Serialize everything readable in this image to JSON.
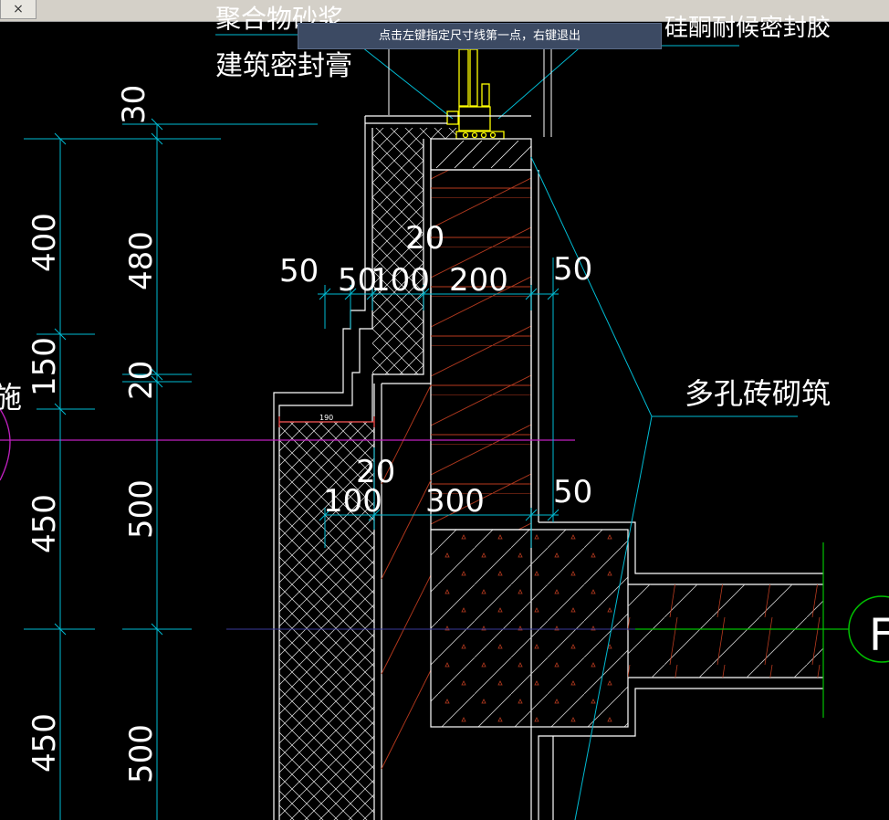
{
  "window": {
    "close_glyph": "×"
  },
  "command_prompt": "点击左键指定尺寸线第一点，右键退出",
  "labels": {
    "top_partial_left": "聚合物砂浆",
    "top_partial_right": "硅酮耐候密封胶",
    "sealant": "建筑密封膏",
    "brick": "多孔砖砌筑",
    "left_partial": "施",
    "axis_tag": "F"
  },
  "dimensions": {
    "d30": "30",
    "d400": "400",
    "d480": "480",
    "d150": "150",
    "d20_vertical": "20",
    "d450_a": "450",
    "d500_a": "500",
    "d450_b": "450",
    "d500_b": "500",
    "d50_left": "50",
    "d50": "50",
    "d100": "100",
    "d200": "200",
    "d50_right": "50",
    "d20_upper": "20",
    "d190": "190",
    "d20_lower": "20",
    "d100_lower": "100",
    "d300": "300",
    "d50_lower": "50"
  },
  "colors": {
    "background": "#000000",
    "wall_outline": "#ffffff",
    "dimension_lines": "#00bcd4",
    "brick_hatch": "#b83a1e",
    "magenta_axis": "#c020c0",
    "axis_green": "#00c000",
    "window_frame": "#ffff00"
  }
}
